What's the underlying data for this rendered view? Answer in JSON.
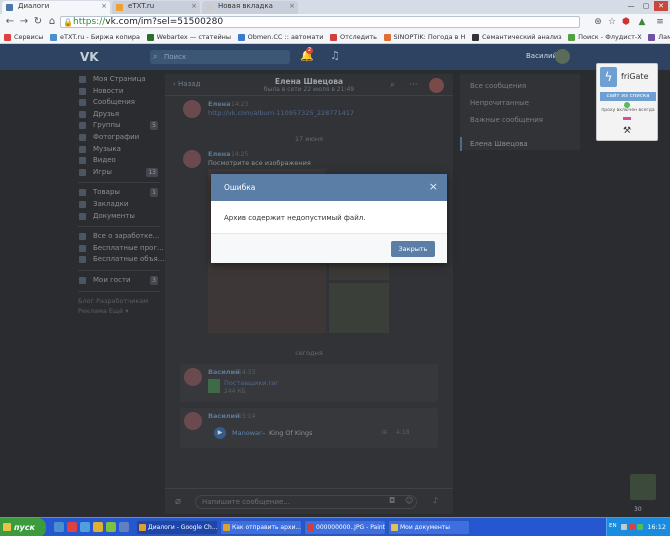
{
  "browser": {
    "tabs": [
      {
        "label": "Диалоги",
        "color": "#4a76a8"
      },
      {
        "label": "eTXT.ru",
        "color": "#f0a030"
      },
      {
        "label": "Новая вкладка",
        "color": "#cccccc"
      }
    ],
    "url_scheme": "https://",
    "url_rest": "vk.com/im?sel=51500280",
    "bookmarks": [
      {
        "label": "Сервисы",
        "color": "#e04040"
      },
      {
        "label": "eTXT.ru - Биржа копира",
        "color": "#4a90d0"
      },
      {
        "label": "Webartex — статейны",
        "color": "#2a6e2a"
      },
      {
        "label": "Obmen.CC :: автомати",
        "color": "#3a7ad0"
      },
      {
        "label": "Отследить",
        "color": "#d04040"
      },
      {
        "label": "SINOPTIK: Погода в Н",
        "color": "#e07030"
      },
      {
        "label": "Семантический анализ",
        "color": "#333333"
      },
      {
        "label": "Поиск - Флудист-Х",
        "color": "#50a040"
      },
      {
        "label": "Лампа LED 5W E27 сво",
        "color": "#7050a0"
      }
    ]
  },
  "vk": {
    "logo": "VK",
    "search_placeholder": "Поиск",
    "notif_count": "2",
    "user_name": "Василий"
  },
  "sidebar": {
    "items": [
      {
        "label": "Моя Страница",
        "count": ""
      },
      {
        "label": "Новости",
        "count": ""
      },
      {
        "label": "Сообщения",
        "count": ""
      },
      {
        "label": "Друзья",
        "count": ""
      },
      {
        "label": "Группы",
        "count": "5"
      },
      {
        "label": "Фотографии",
        "count": ""
      },
      {
        "label": "Музыка",
        "count": ""
      },
      {
        "label": "Видео",
        "count": ""
      },
      {
        "label": "Игры",
        "count": "13"
      }
    ],
    "items2": [
      {
        "label": "Товары",
        "count": "1"
      },
      {
        "label": "Закладки",
        "count": ""
      },
      {
        "label": "Документы",
        "count": ""
      }
    ],
    "items3": [
      {
        "label": "Все о заработке...",
        "count": ""
      },
      {
        "label": "Бесплатные прог...",
        "count": ""
      },
      {
        "label": "Бесплатные объя...",
        "count": ""
      }
    ],
    "items4": [
      {
        "label": "Мои гости",
        "count": "3"
      }
    ],
    "footer": [
      "Блог   Разработчикам",
      "Реклама   Ещё ▾"
    ]
  },
  "chat": {
    "back": "Назад",
    "name": "Елена Швецова",
    "status": "была в сети 22 июля в 21:49",
    "msg1": {
      "name": "Елена",
      "time": "14:23",
      "link": "http://vk.com/album-110957325_228771417"
    },
    "date1": "17 июня",
    "msg2": {
      "name": "Елена",
      "time": "14:25",
      "text": "Посмотрите все изображения"
    },
    "date2": "сегодня",
    "msg3": {
      "name": "Василий",
      "time": "14:33",
      "doc_name": "Поставщики.rar",
      "doc_size": "244 КБ"
    },
    "msg4": {
      "name": "Василий",
      "time": "15:14",
      "artist": "Manowar",
      "dash": "–",
      "track": "King Of Kings",
      "duration": "4:18"
    },
    "input_placeholder": "Напишите сообщение..."
  },
  "right_menu": {
    "items": [
      "Все сообщения",
      "Непрочитанные",
      "Важные сообщения"
    ],
    "active": "Елена Швецова"
  },
  "frigate": {
    "title": "friGate",
    "button": "сайт из списка www",
    "status": "проху включен всегда"
  },
  "online_count": "30",
  "modal": {
    "title": "Ошибка",
    "body": "Архив содержит недопустимый файл.",
    "button": "Закрыть"
  },
  "taskbar": {
    "start": "пуск",
    "tasks": [
      {
        "label": "Диалоги - Google Ch...",
        "color": "#e0a030"
      },
      {
        "label": "Как отправить архи...",
        "color": "#e0a030"
      },
      {
        "label": "000000000..JPG - Paint",
        "color": "#d04040"
      },
      {
        "label": "Мои документы",
        "color": "#e0c060"
      }
    ],
    "lang": "EN",
    "clock": "16:12"
  }
}
